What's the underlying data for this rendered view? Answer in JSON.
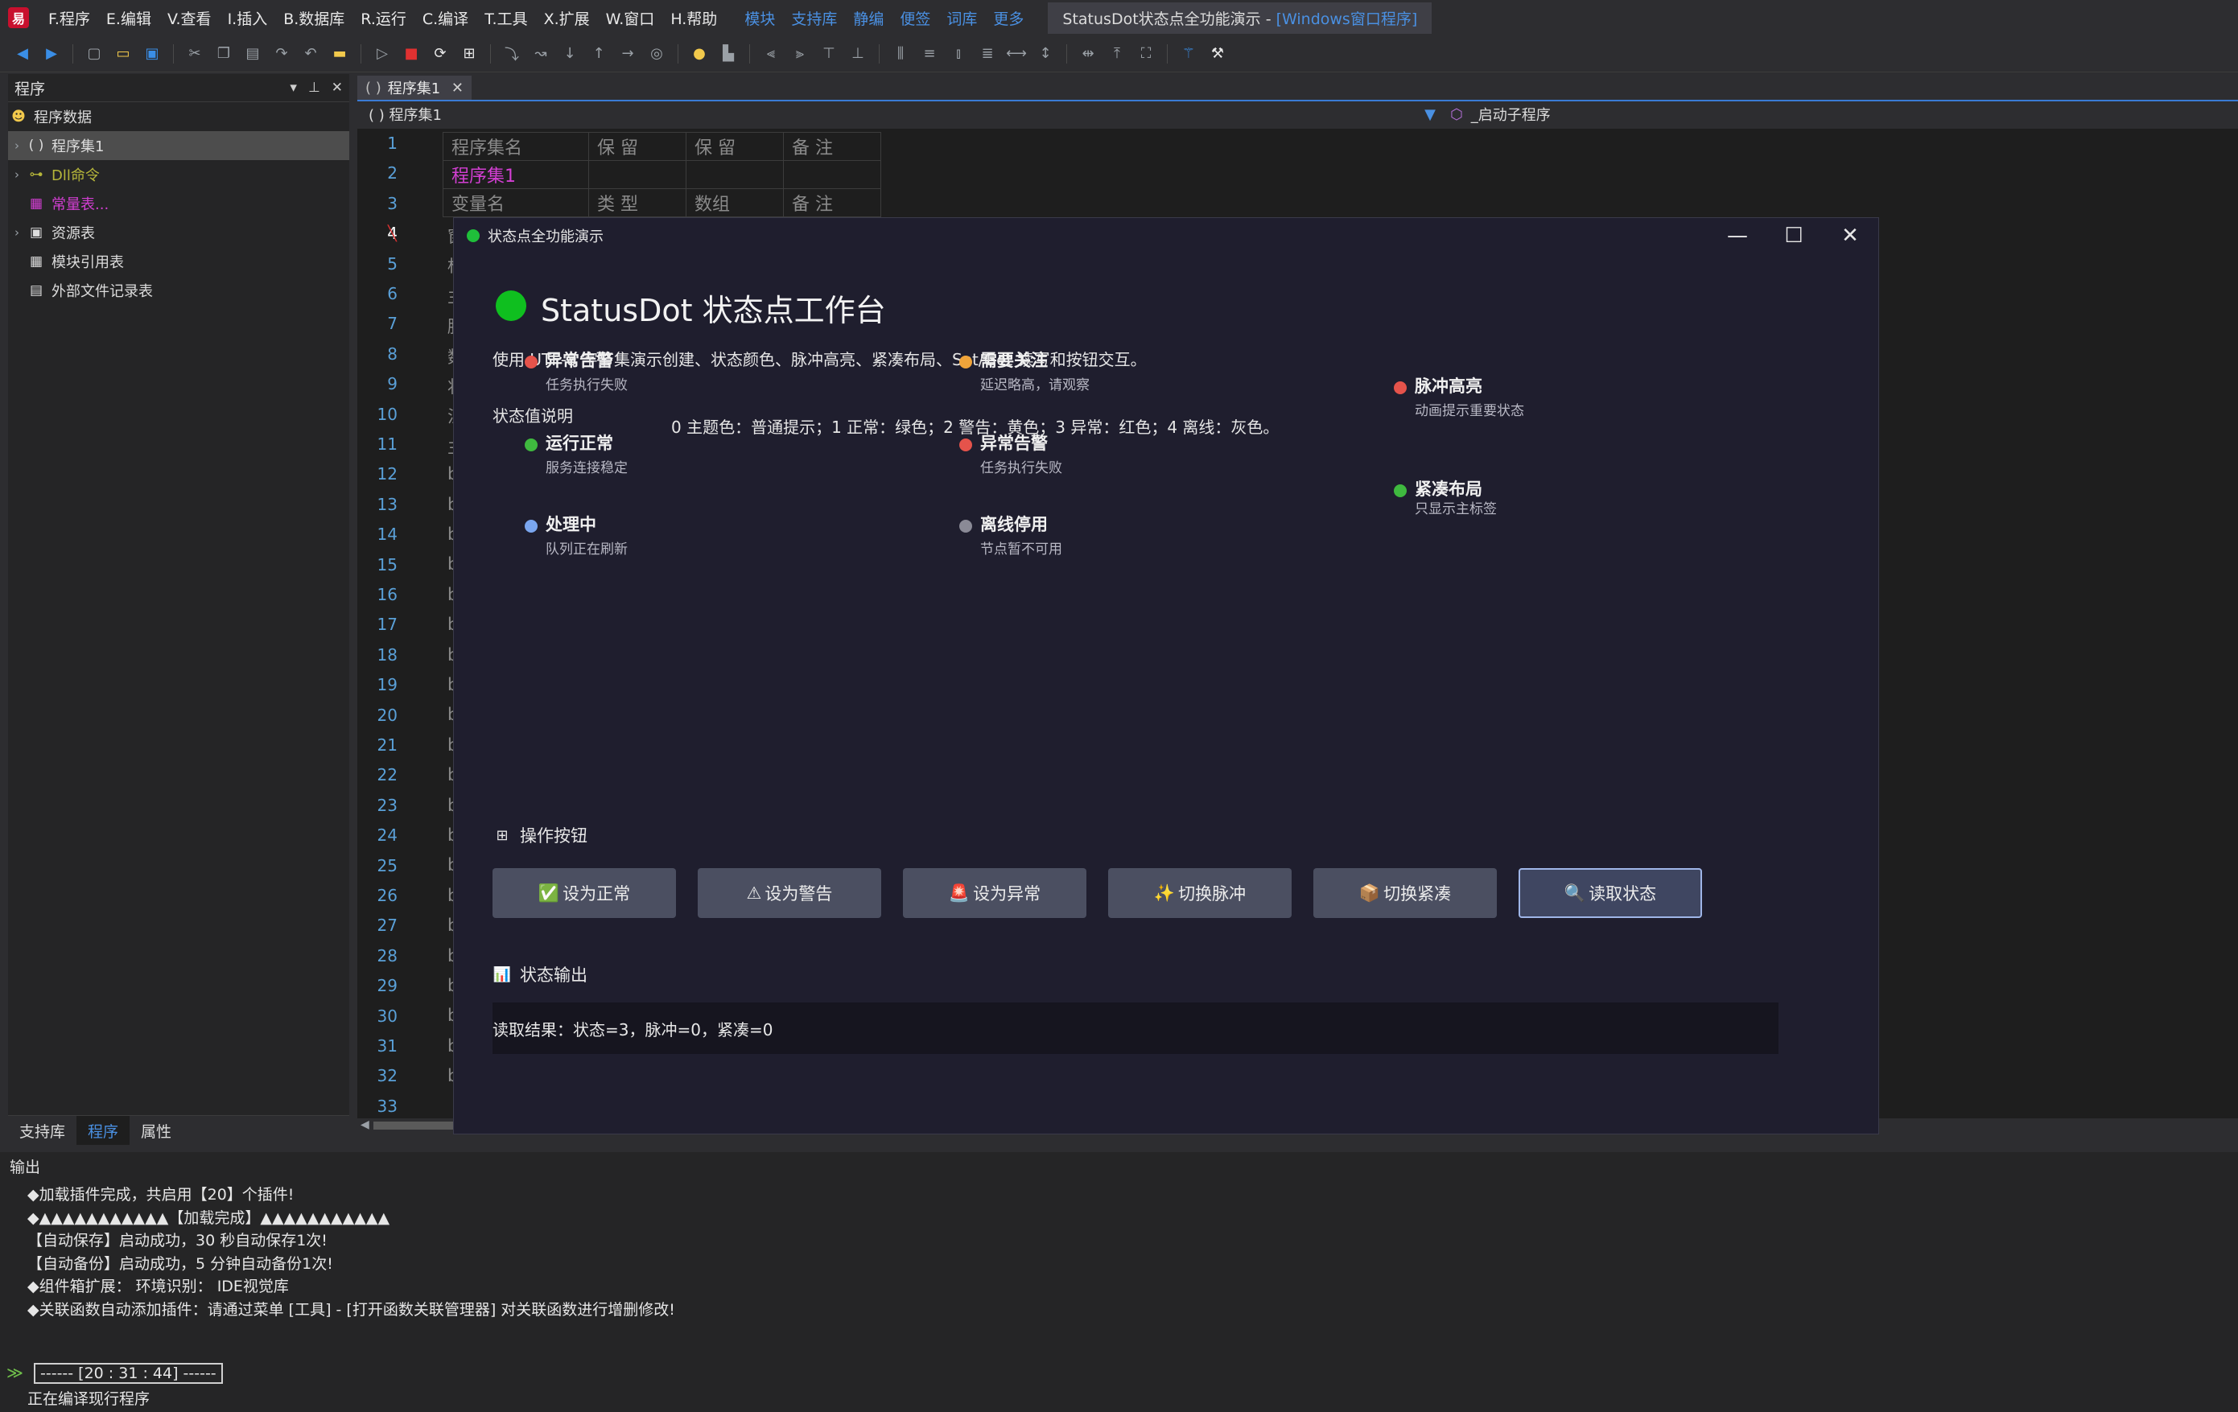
{
  "menu": {
    "items": [
      "F.程序",
      "E.编辑",
      "V.查看",
      "I.插入",
      "B.数据库",
      "R.运行",
      "C.编译",
      "T.工具",
      "X.扩展",
      "W.窗口",
      "H.帮助"
    ],
    "links": [
      "模块",
      "支持库",
      "静编",
      "便签",
      "词库",
      "更多"
    ],
    "window_title_prefix": "StatusDot状态点全功能演示 - ",
    "window_title_suffix": "[Windows窗口程序]"
  },
  "left_panel": {
    "title": "程序",
    "root": "程序数据",
    "items": [
      {
        "label": "程序集1",
        "icon": "( )",
        "color": "#dcdcdc",
        "expand": true,
        "selected": true
      },
      {
        "label": "Dll命令",
        "icon": "⊶",
        "color": "#b5b53a",
        "expand": true,
        "selected": false
      },
      {
        "label": "常量表...",
        "icon": "▦",
        "color": "#d33fd3",
        "expand": false,
        "selected": false
      },
      {
        "label": "资源表",
        "icon": "▣",
        "color": "#dcdcdc",
        "expand": true,
        "selected": false
      },
      {
        "label": "模块引用表",
        "icon": "▦",
        "color": "#dcdcdc",
        "expand": false,
        "selected": false
      },
      {
        "label": "外部文件记录表",
        "icon": "▤",
        "color": "#dcdcdc",
        "expand": false,
        "selected": false
      }
    ],
    "tabs": [
      "支持库",
      "程序",
      "属性"
    ],
    "active_tab": "程序"
  },
  "editor": {
    "tab_label": "程序集1",
    "nav_left": "( ) 程序集1",
    "nav_right": "_启动子程序",
    "table_rows": [
      [
        "程序集名",
        "保 留",
        "保 留",
        "备 注"
      ],
      [
        "程序集1",
        "",
        "",
        ""
      ],
      [
        "变量名",
        "类 型",
        "数组",
        "备 注"
      ]
    ],
    "line_numbers": [
      "1",
      "2",
      "3",
      "4",
      "5",
      "6",
      "7",
      "8",
      "9",
      "10",
      "11",
      "12",
      "13",
      "14",
      "15",
      "16",
      "17",
      "18",
      "19",
      "20",
      "21",
      "22",
      "23",
      "24",
      "25",
      "26",
      "27",
      "28",
      "29",
      "30",
      "31",
      "32",
      "33"
    ],
    "current_line": "4",
    "code_fragments": [
      "窗",
      "标",
      "主",
      "脉",
      "数",
      "状",
      "注",
      "主",
      "b",
      "b",
      "b",
      "b",
      "b",
      "b",
      "b",
      "b",
      "b",
      "b",
      "b",
      "b",
      "b",
      "b",
      "b",
      "b",
      "b",
      "b",
      "b",
      "b",
      "b"
    ]
  },
  "dialog": {
    "title": "状态点全功能演示",
    "heading": "StatusDot 状态点工作台",
    "description": "使用 UTF-8 字节集演示创建、状态颜色、脉冲高亮、紧凑布局、Set/Get 读写和按钮交互。",
    "legend_label": "状态值说明",
    "legend_text": "0 主题色：普通提示；1 正常：绿色；2 警告：黄色；3 异常：红色；4 离线：灰色。",
    "status_items": [
      {
        "title": "异常告警",
        "desc": "任务执行失败",
        "color": "#e5534b"
      },
      {
        "title": "需要关注",
        "desc": "延迟略高，请观察",
        "color": "#f0a43a"
      },
      {
        "title": "脉冲高亮",
        "desc": "动画提示重要状态",
        "color": "#e5534b"
      },
      {
        "title": "运行正常",
        "desc": "服务连接稳定",
        "color": "#3fb93f"
      },
      {
        "title": "异常告警",
        "desc": "任务执行失败",
        "color": "#e5534b"
      },
      {
        "title": "紧凑布局",
        "desc": "只显示主标签",
        "color": "#3fb93f"
      },
      {
        "title": "处理中",
        "desc": "队列正在刷新",
        "color": "#7aa6ef"
      },
      {
        "title": "离线停用",
        "desc": "节点暂不可用",
        "color": "#8a8a96"
      }
    ],
    "buttons_header": "操作按钮",
    "buttons": [
      {
        "icon": "✅",
        "label": "设为正常"
      },
      {
        "icon": "⚠",
        "label": "设为警告"
      },
      {
        "icon": "🚨",
        "label": "设为异常"
      },
      {
        "icon": "✨",
        "label": "切换脉冲"
      },
      {
        "icon": "📦",
        "label": "切换紧凑"
      },
      {
        "icon": "🔍",
        "label": "读取状态"
      }
    ],
    "output_header": "状态输出",
    "output_text": "读取结果：状态=3，脉冲=0，紧凑=0"
  },
  "output_panel": {
    "title": "输出",
    "lines": [
      "◆加载插件完成，共启用【20】个插件!",
      "◆▲▲▲▲▲▲▲▲▲▲▲【加载完成】▲▲▲▲▲▲▲▲▲▲▲",
      "【自动保存】启动成功，30 秒自动保存1次!",
      "【自动备份】启动成功，5 分钟自动备份1次!",
      "◆组件箱扩展：  环境识别：  IDE视觉库",
      "◆关联函数自动添加插件：请通过菜单 [工具] - [打开函数关联管理器] 对关联函数进行增删修改!"
    ],
    "time_stamp": "------ [20 : 31 : 44] ------",
    "status_line": "正在编译现行程序"
  }
}
